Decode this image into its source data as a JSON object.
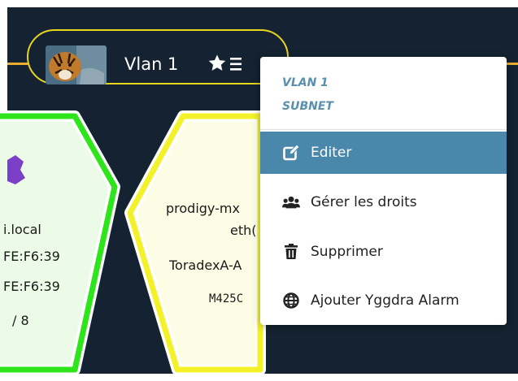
{
  "vlan": {
    "title": "Vlan 1"
  },
  "left_hex": {
    "lines": [
      "i.local",
      "FE:F6:39",
      "FE:F6:39",
      "/ 8"
    ]
  },
  "mid_hex": {
    "lines": [
      "prodigy-mx",
      "eth(",
      "ToradexA-A",
      "M425C"
    ]
  },
  "dropdown": {
    "header_line1": "VLAN 1",
    "header_line2": "SUBNET",
    "items": [
      {
        "label": "Editer",
        "icon": "edit-icon"
      },
      {
        "label": "Gérer les droits",
        "icon": "users-icon"
      },
      {
        "label": "Supprimer",
        "icon": "trash-icon"
      },
      {
        "label": "Ajouter Yggdra Alarm",
        "icon": "globe-icon"
      }
    ]
  },
  "colors": {
    "background": "#142231",
    "link_line": "#e8ad2c",
    "pill_border": "#e9d51e",
    "left_hex_border": "#2ee51b",
    "left_hex_fill": "#ecfbe8",
    "mid_hex_border": "#f3f22a",
    "mid_hex_fill": "#fdfde6",
    "menu_active": "#4a88ab",
    "menu_header": "#5a90ad",
    "badge_purple": "#7b3fc8"
  }
}
